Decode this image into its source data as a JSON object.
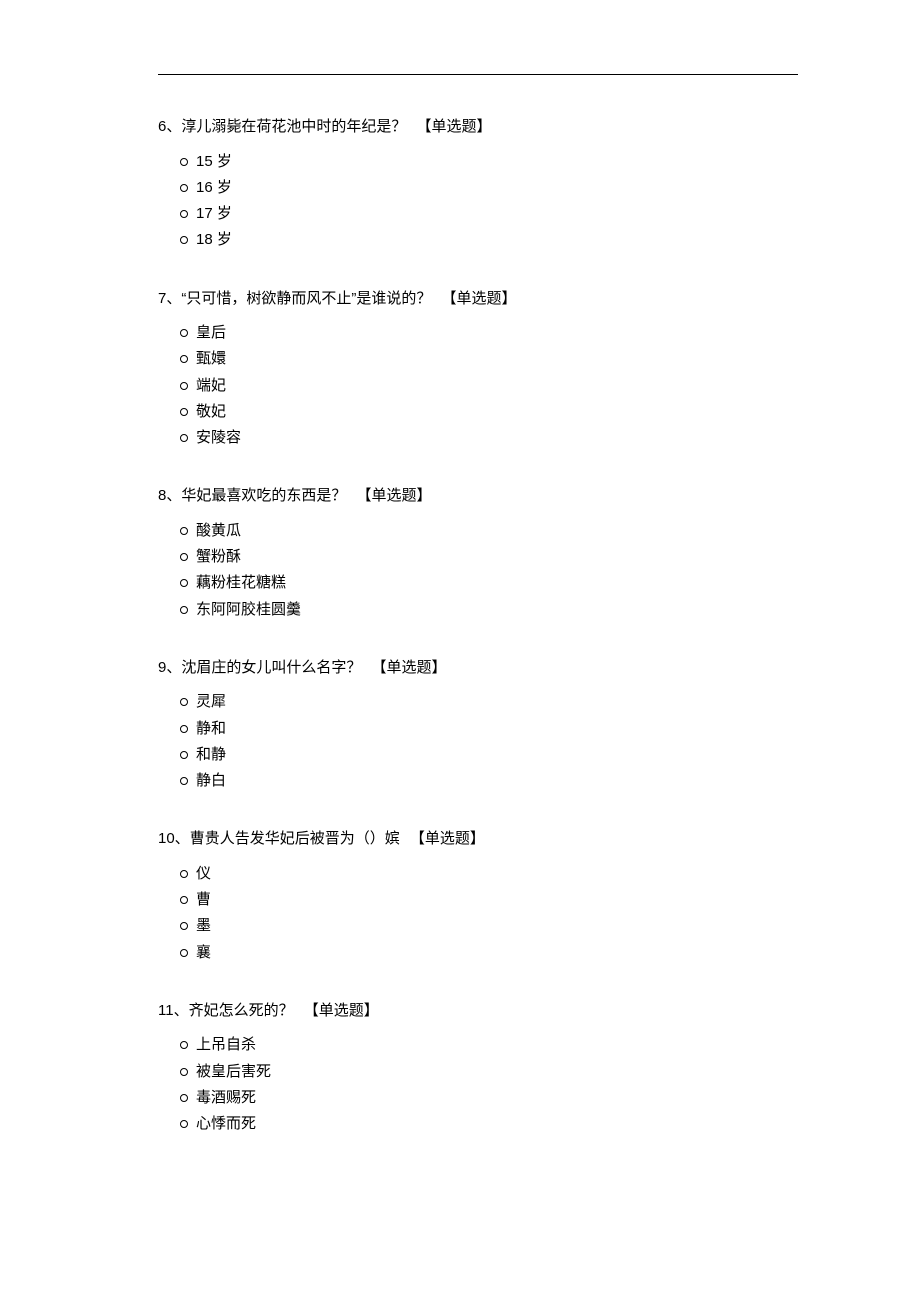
{
  "tag_label": "【单选题】",
  "questions": [
    {
      "number": "6、",
      "text": "淳儿溺毙在荷花池中时的年纪是？",
      "options": [
        "15 岁",
        "16 岁",
        "17 岁",
        "18 岁"
      ]
    },
    {
      "number": "7、",
      "text": "“只可惜，树欲静而风不止”是谁说的？",
      "options": [
        "皇后",
        "甄嬛",
        "端妃",
        "敬妃",
        "安陵容"
      ]
    },
    {
      "number": "8、",
      "text": "华妃最喜欢吃的东西是？",
      "options": [
        "酸黄瓜",
        "蟹粉酥",
        "藕粉桂花糖糕",
        "东阿阿胶桂圆羹"
      ]
    },
    {
      "number": "9、",
      "text": "沈眉庄的女儿叫什么名字？",
      "options": [
        "灵犀",
        "静和",
        "和静",
        "静白"
      ]
    },
    {
      "number": "10、",
      "text": "曹贵人告发华妃后被晋为（）嫔",
      "options": [
        "仪",
        "曹",
        "墨",
        "襄"
      ]
    },
    {
      "number": "11、",
      "text": "齐妃怎么死的？",
      "options": [
        "上吊自杀",
        "被皇后害死",
        "毒酒赐死",
        "心悸而死"
      ]
    }
  ]
}
